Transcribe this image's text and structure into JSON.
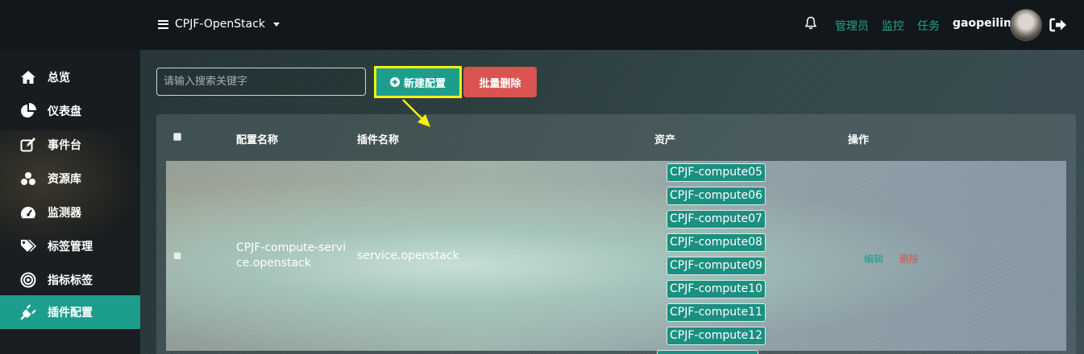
{
  "header": {
    "project": "CPJF-OpenStack",
    "links": [
      "管理员",
      "监控",
      "任务"
    ],
    "user": "gaopeilin"
  },
  "sidebar": {
    "items": [
      {
        "label": "总览",
        "icon": "home-icon"
      },
      {
        "label": "仪表盘",
        "icon": "pie-chart-icon"
      },
      {
        "label": "事件台",
        "icon": "edit-icon"
      },
      {
        "label": "资源库",
        "icon": "cubes-icon"
      },
      {
        "label": "监测器",
        "icon": "dashboard-icon"
      },
      {
        "label": "标签管理",
        "icon": "tags-icon"
      },
      {
        "label": "指标标签",
        "icon": "target-icon"
      },
      {
        "label": "插件配置",
        "icon": "plug-icon",
        "active": true
      }
    ]
  },
  "toolbar": {
    "search_placeholder": "请输入搜索关键字",
    "new_label": "新建配置",
    "batch_delete_label": "批量删除"
  },
  "table": {
    "headers": [
      "配置名称",
      "插件名称",
      "资产",
      "操作"
    ],
    "rows": [
      {
        "config_name_line1": "CPJF-compute-servi",
        "config_name_line2": "ce.openstack",
        "plugin": "service.openstack",
        "assets": [
          "CPJF-compute05",
          "CPJF-compute06",
          "CPJF-compute07",
          "CPJF-compute08",
          "CPJF-compute09",
          "CPJF-compute10",
          "CPJF-compute11",
          "CPJF-compute12"
        ],
        "edit": "编辑",
        "delete": "删除"
      }
    ]
  },
  "colors": {
    "accent": "#1d9e8c",
    "danger": "#d9534f",
    "highlight": "#f3f014"
  }
}
